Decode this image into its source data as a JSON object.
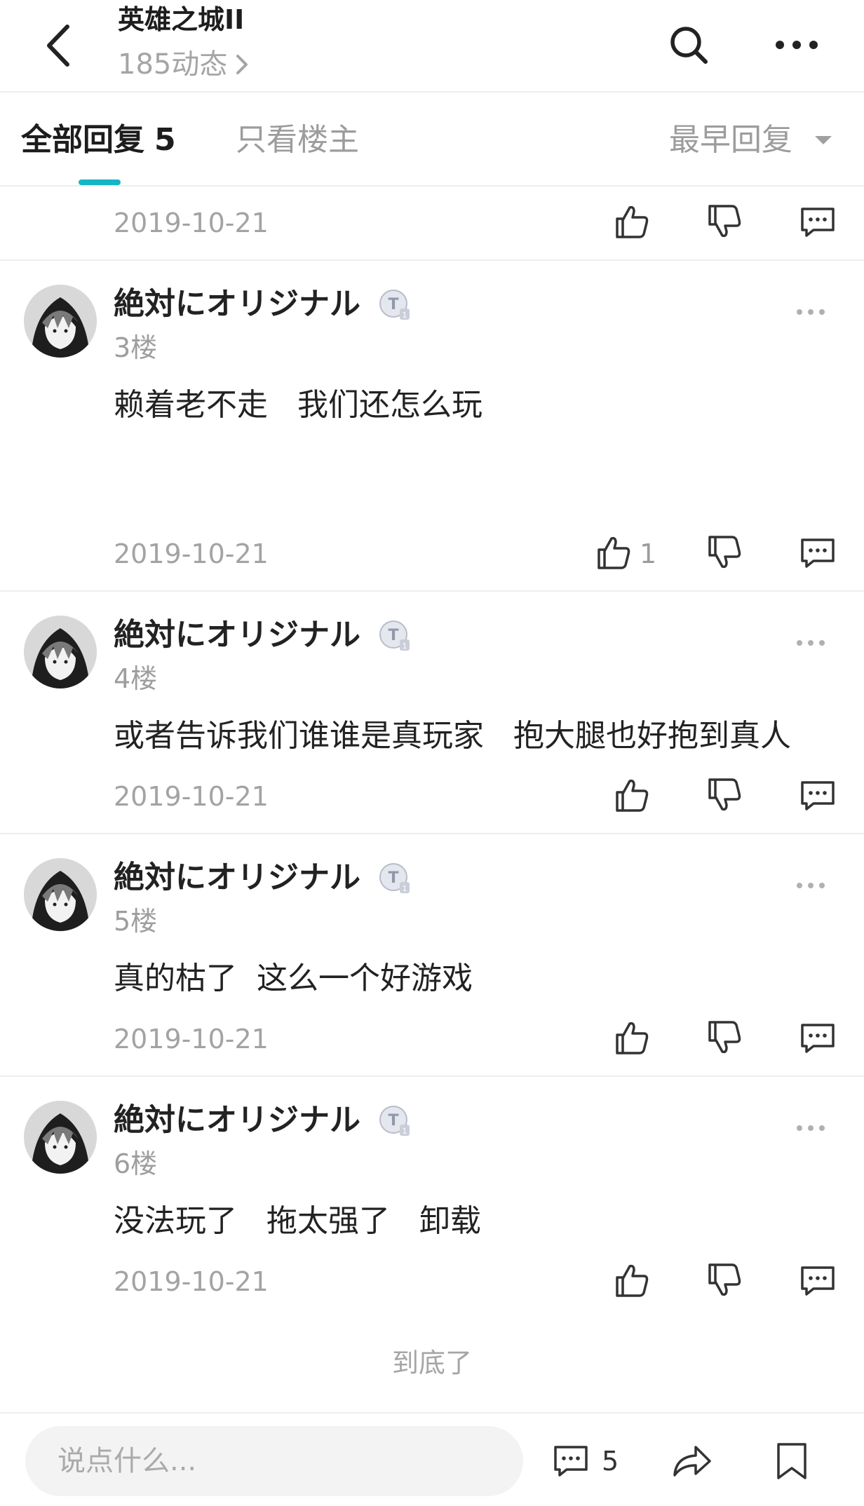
{
  "header": {
    "title": "英雄之城II",
    "subtitle": "185动态"
  },
  "tabs": {
    "all_label": "全部回复",
    "all_count": "5",
    "op_only_label": "只看楼主",
    "sort_label": "最早回复"
  },
  "top_partial": {
    "date": "2019-10-21"
  },
  "comments": [
    {
      "username": "絶対にオリジナル",
      "floor": "3楼",
      "content": "赖着老不走   我们还怎么玩",
      "date": "2019-10-21",
      "likes": "1"
    },
    {
      "username": "絶対にオリジナル",
      "floor": "4楼",
      "content": "或者告诉我们谁谁是真玩家   抱大腿也好抱到真人",
      "date": "2019-10-21",
      "likes": ""
    },
    {
      "username": "絶対にオリジナル",
      "floor": "5楼",
      "content": "真的枯了  这么一个好游戏",
      "date": "2019-10-21",
      "likes": ""
    },
    {
      "username": "絶対にオリジナル",
      "floor": "6楼",
      "content": "没法玩了   拖太强了   卸载",
      "date": "2019-10-21",
      "likes": ""
    }
  ],
  "footer": {
    "end_text": "到底了"
  },
  "bottom_bar": {
    "placeholder": "说点什么...",
    "comment_count": "5"
  },
  "colors": {
    "accent": "#15b5c6",
    "text_primary": "#222222",
    "text_secondary": "#a3a3a3",
    "divider": "#eeeeee"
  }
}
